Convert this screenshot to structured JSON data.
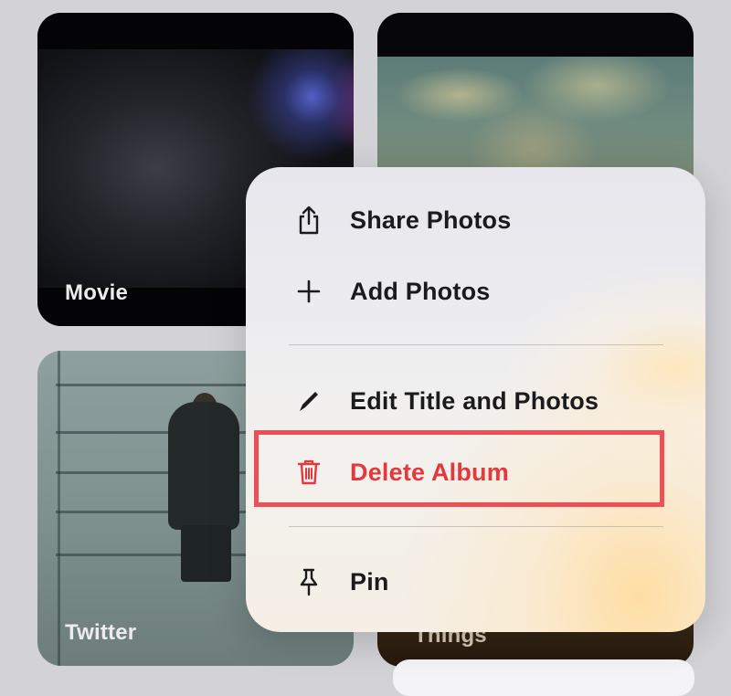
{
  "albums": [
    {
      "label": "Movie"
    },
    {
      "label": ""
    },
    {
      "label": "Twitter"
    },
    {
      "label": "Things"
    }
  ],
  "menu": {
    "items": [
      {
        "label": "Share Photos",
        "icon": "share-icon"
      },
      {
        "label": "Add Photos",
        "icon": "plus-icon"
      },
      {
        "label": "Edit Title and Photos",
        "icon": "pencil-icon"
      },
      {
        "label": "Delete Album",
        "icon": "trash-icon",
        "color": "#e5383d"
      },
      {
        "label": "Pin",
        "icon": "pin-icon"
      }
    ]
  },
  "colors": {
    "destructive": "#e5383d",
    "highlight_border": "#ee4e56",
    "background": "#d2d2d7"
  }
}
